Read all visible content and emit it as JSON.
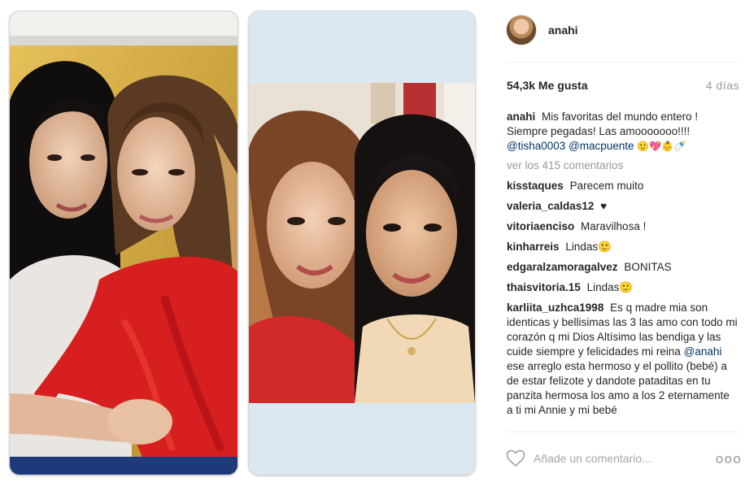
{
  "post": {
    "author": "anahi",
    "likes": "54,3k Me gusta",
    "age": "4 días",
    "caption": {
      "user": "anahi",
      "text": "Mis favoritas del mundo entero ! Siempre pegadas! Las amooooooo!!!!",
      "mention_1": "@tisha0003",
      "mention_2": "@macpuente",
      "emoji": "🙂💖👶🍼"
    },
    "load_more": "ver los 415 comentarios",
    "comments": [
      {
        "user": "kisstaques",
        "text": "Parecem muito"
      },
      {
        "user": "valeria_caldas12",
        "text": "♥"
      },
      {
        "user": "vitoriaenciso",
        "text": "Maravilhosa !"
      },
      {
        "user": "kinharreis",
        "text": "Lindas🙂"
      },
      {
        "user": "edgaralzamoragalvez",
        "text": "BONITAS"
      },
      {
        "user": "thaisvitoria.15",
        "text": "Lindas🙂"
      }
    ],
    "long_comment": {
      "user": "karliita_uzhca1998",
      "text_1": "Es q madre mia son identicas y bellisimas las 3 las amo con todo mi corazón q mi Dios Altísimo las bendiga y las cuide siempre y felicidades mi reina",
      "mention": "@anahi",
      "text_2": "ese arreglo esta hermoso y el pollito (bebé) a de estar felizote y dandote pataditas en tu panzita hermosa los amo a los 2 eternamente a ti mi Annie y mi bebé"
    },
    "add_comment_placeholder": "Añade un comentario...",
    "more_options": "ooo"
  },
  "icons": {
    "like": "heart-outline-icon",
    "options": "more-options-icon"
  },
  "colors": {
    "mention": "#003569",
    "muted": "#999999",
    "text": "#262626"
  }
}
